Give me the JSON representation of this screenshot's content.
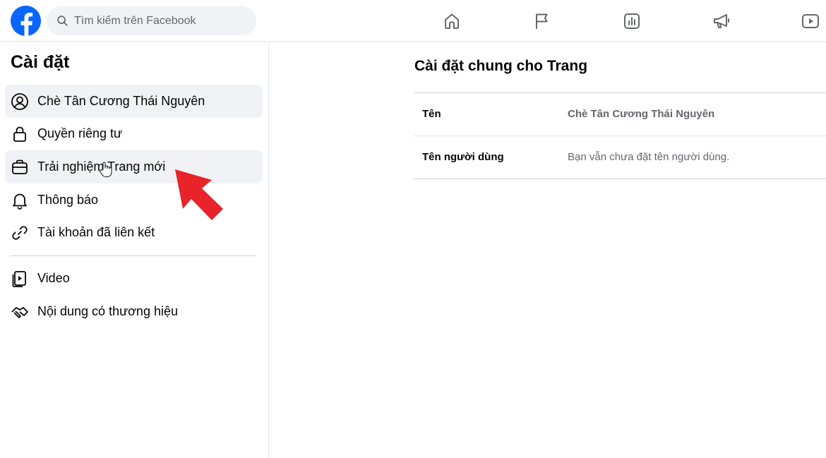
{
  "search": {
    "placeholder": "Tìm kiếm trên Facebook"
  },
  "nav": [
    "home-icon",
    "flag-icon",
    "insights-icon",
    "megaphone-icon",
    "video-icon"
  ],
  "sidebar": {
    "title": "Cài đặt",
    "items": [
      {
        "label": "Chè Tân Cương Thái Nguyên",
        "icon": "user-circle-icon",
        "active": true
      },
      {
        "label": "Quyền riêng tư",
        "icon": "lock-icon"
      },
      {
        "label": "Trải nghiệm Trang mới",
        "icon": "briefcase-icon",
        "hovered": true
      },
      {
        "label": "Thông báo",
        "icon": "bell-icon"
      },
      {
        "label": "Tài khoản đã liên kết",
        "icon": "link-icon"
      },
      {
        "label": "Video",
        "icon": "video-file-icon"
      },
      {
        "label": "Nội dung có thương hiệu",
        "icon": "handshake-icon"
      }
    ]
  },
  "main": {
    "title": "Cài đặt chung cho Trang",
    "rows": [
      {
        "key": "Tên",
        "value": "Chè Tân Cương Thái Nguyên"
      },
      {
        "key": "Tên người dùng",
        "value": "Bạn vẫn chưa đặt tên người dùng."
      }
    ]
  },
  "colors": {
    "brand": "#0866ff",
    "arrow": "#e8232a",
    "hover": "#f0f2f5"
  }
}
